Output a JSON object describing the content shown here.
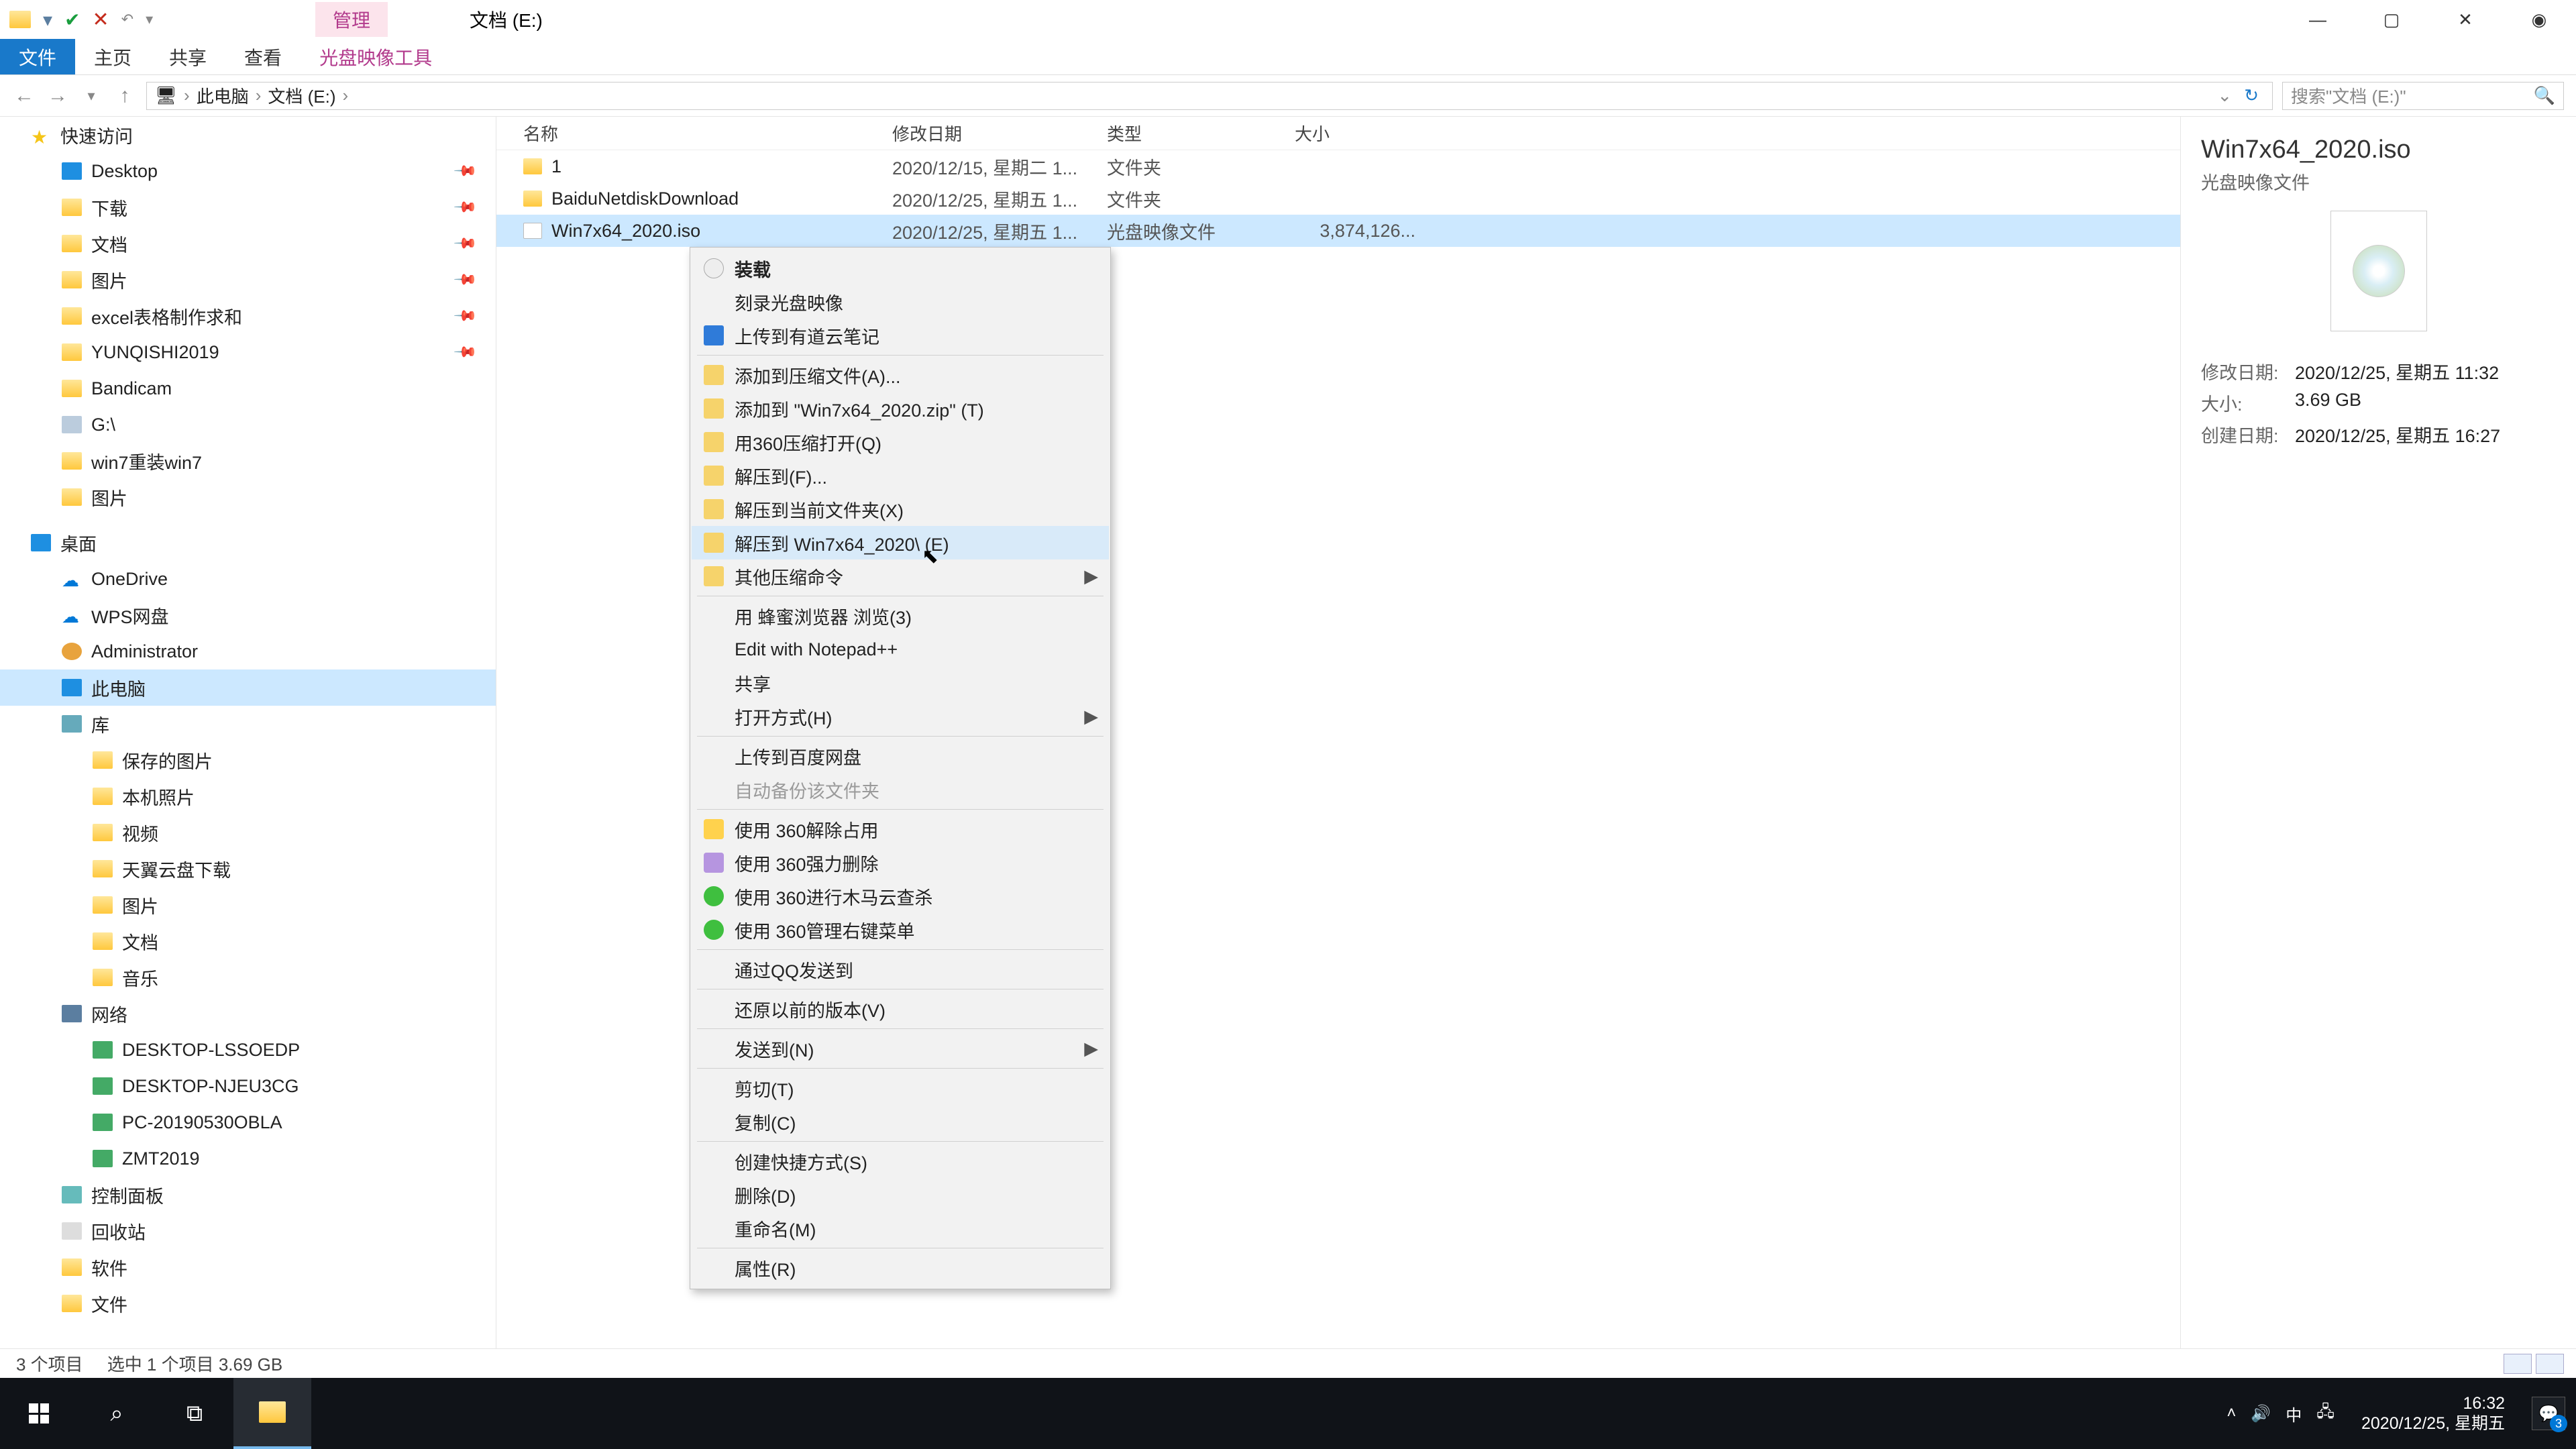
{
  "titlebar": {
    "tab_highlight": "管理",
    "title": "文档 (E:)"
  },
  "ribbon": {
    "file": "文件",
    "home": "主页",
    "share": "共享",
    "view": "查看",
    "tool": "光盘映像工具"
  },
  "breadcrumb": {
    "pc": "此电脑",
    "drive": "文档 (E:)"
  },
  "search": {
    "placeholder": "搜索\"文档 (E:)\""
  },
  "sidebar": {
    "quick": "快速访问",
    "desktop": "Desktop",
    "downloads": "下载",
    "documents": "文档",
    "pictures": "图片",
    "excel": "excel表格制作求和",
    "yunqishi": "YUNQISHI2019",
    "bandicam": "Bandicam",
    "gdrive": "G:\\",
    "win7rein": "win7重装win7",
    "pictures2": "图片",
    "desktop_zh": "桌面",
    "onedrive": "OneDrive",
    "wps": "WPS网盘",
    "admin": "Administrator",
    "thispc": "此电脑",
    "lib": "库",
    "savedpic": "保存的图片",
    "localpic": "本机照片",
    "videos": "视频",
    "tianyi": "天翼云盘下载",
    "pictures3": "图片",
    "docs": "文档",
    "music": "音乐",
    "network": "网络",
    "net1": "DESKTOP-LSSOEDP",
    "net2": "DESKTOP-NJEU3CG",
    "net3": "PC-20190530OBLA",
    "net4": "ZMT2019",
    "ctrlpanel": "控制面板",
    "recycle": "回收站",
    "software": "软件",
    "files": "文件"
  },
  "columns": {
    "name": "名称",
    "date": "修改日期",
    "type": "类型",
    "size": "大小"
  },
  "rows": [
    {
      "name": "1",
      "date": "2020/12/15, 星期二 1...",
      "type": "文件夹",
      "size": "",
      "icon": "folder"
    },
    {
      "name": "BaiduNetdiskDownload",
      "date": "2020/12/25, 星期五 1...",
      "type": "文件夹",
      "size": "",
      "icon": "folder"
    },
    {
      "name": "Win7x64_2020.iso",
      "date": "2020/12/25, 星期五 1...",
      "type": "光盘映像文件",
      "size": "3,874,126...",
      "icon": "iso",
      "selected": true
    }
  ],
  "ctx": [
    {
      "label": "装载",
      "icon": "odisk",
      "bold": true
    },
    {
      "label": "刻录光盘映像"
    },
    {
      "label": "上传到有道云笔记",
      "icon": "cloudup"
    },
    {
      "sep": true
    },
    {
      "label": "添加到压缩文件(A)...",
      "icon": "zip"
    },
    {
      "label": "添加到 \"Win7x64_2020.zip\" (T)",
      "icon": "zip"
    },
    {
      "label": "用360压缩打开(Q)",
      "icon": "zip"
    },
    {
      "label": "解压到(F)...",
      "icon": "zip"
    },
    {
      "label": "解压到当前文件夹(X)",
      "icon": "zip"
    },
    {
      "label": "解压到 Win7x64_2020\\ (E)",
      "icon": "zip",
      "hover": true
    },
    {
      "label": "其他压缩命令",
      "icon": "zip",
      "arrow": true
    },
    {
      "sep": true
    },
    {
      "label": "用 蜂蜜浏览器 浏览(3)",
      "icon": "br"
    },
    {
      "label": "Edit with Notepad++",
      "icon": "npp"
    },
    {
      "label": "共享",
      "icon": "share"
    },
    {
      "label": "打开方式(H)",
      "arrow": true
    },
    {
      "sep": true
    },
    {
      "label": "上传到百度网盘"
    },
    {
      "label": "自动备份该文件夹",
      "disabled": true
    },
    {
      "sep": true
    },
    {
      "label": "使用 360解除占用",
      "icon": "sh360"
    },
    {
      "label": "使用 360强力删除",
      "icon": "sh360p"
    },
    {
      "label": "使用 360进行木马云查杀",
      "icon": "sh360g"
    },
    {
      "label": "使用 360管理右键菜单",
      "icon": "sh360g"
    },
    {
      "sep": true
    },
    {
      "label": "通过QQ发送到"
    },
    {
      "sep": true
    },
    {
      "label": "还原以前的版本(V)"
    },
    {
      "sep": true
    },
    {
      "label": "发送到(N)",
      "arrow": true
    },
    {
      "sep": true
    },
    {
      "label": "剪切(T)"
    },
    {
      "label": "复制(C)"
    },
    {
      "sep": true
    },
    {
      "label": "创建快捷方式(S)"
    },
    {
      "label": "删除(D)"
    },
    {
      "label": "重命名(M)"
    },
    {
      "sep": true
    },
    {
      "label": "属性(R)"
    }
  ],
  "details": {
    "title": "Win7x64_2020.iso",
    "type": "光盘映像文件",
    "mod_k": "修改日期:",
    "mod_v": "2020/12/25, 星期五 11:32",
    "size_k": "大小:",
    "size_v": "3.69 GB",
    "create_k": "创建日期:",
    "create_v": "2020/12/25, 星期五 16:27"
  },
  "status": {
    "count": "3 个项目",
    "selection": "选中 1 个项目  3.69 GB"
  },
  "taskbar": {
    "ime": "中",
    "time": "16:32",
    "date": "2020/12/25, 星期五",
    "badge": "3"
  }
}
